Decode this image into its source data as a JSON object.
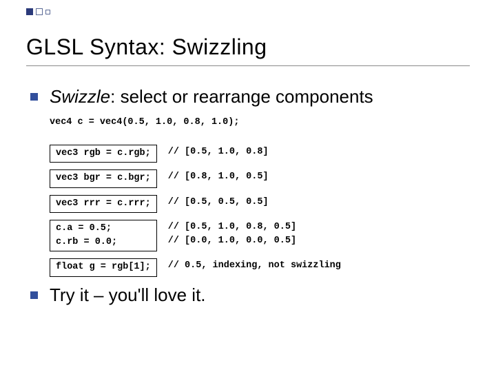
{
  "title": "GLSL Syntax:  Swizzling",
  "bullet1_prefix": "Swizzle",
  "bullet1_rest": ":  select or rearrange components",
  "code_decl": "vec4 c = vec4(0.5, 1.0, 0.8, 1.0);",
  "rows": [
    {
      "code": "vec3 rgb = c.rgb;",
      "comment": "// [0.5, 1.0, 0.8]"
    },
    {
      "code": "vec3 bgr = c.bgr;",
      "comment": "// [0.8, 1.0, 0.5]"
    },
    {
      "code": "vec3 rrr = c.rrr;",
      "comment": "// [0.5, 0.5, 0.5]"
    },
    {
      "code": "c.a = 0.5;\nc.rb = 0.0;",
      "comment": "// [0.5, 1.0, 0.8, 0.5]\n// [0.0, 1.0, 0.0, 0.5]"
    },
    {
      "code": "float g = rgb[1];",
      "comment": "// 0.5, indexing, not swizzling"
    }
  ],
  "bullet2": "Try it – you'll love it."
}
